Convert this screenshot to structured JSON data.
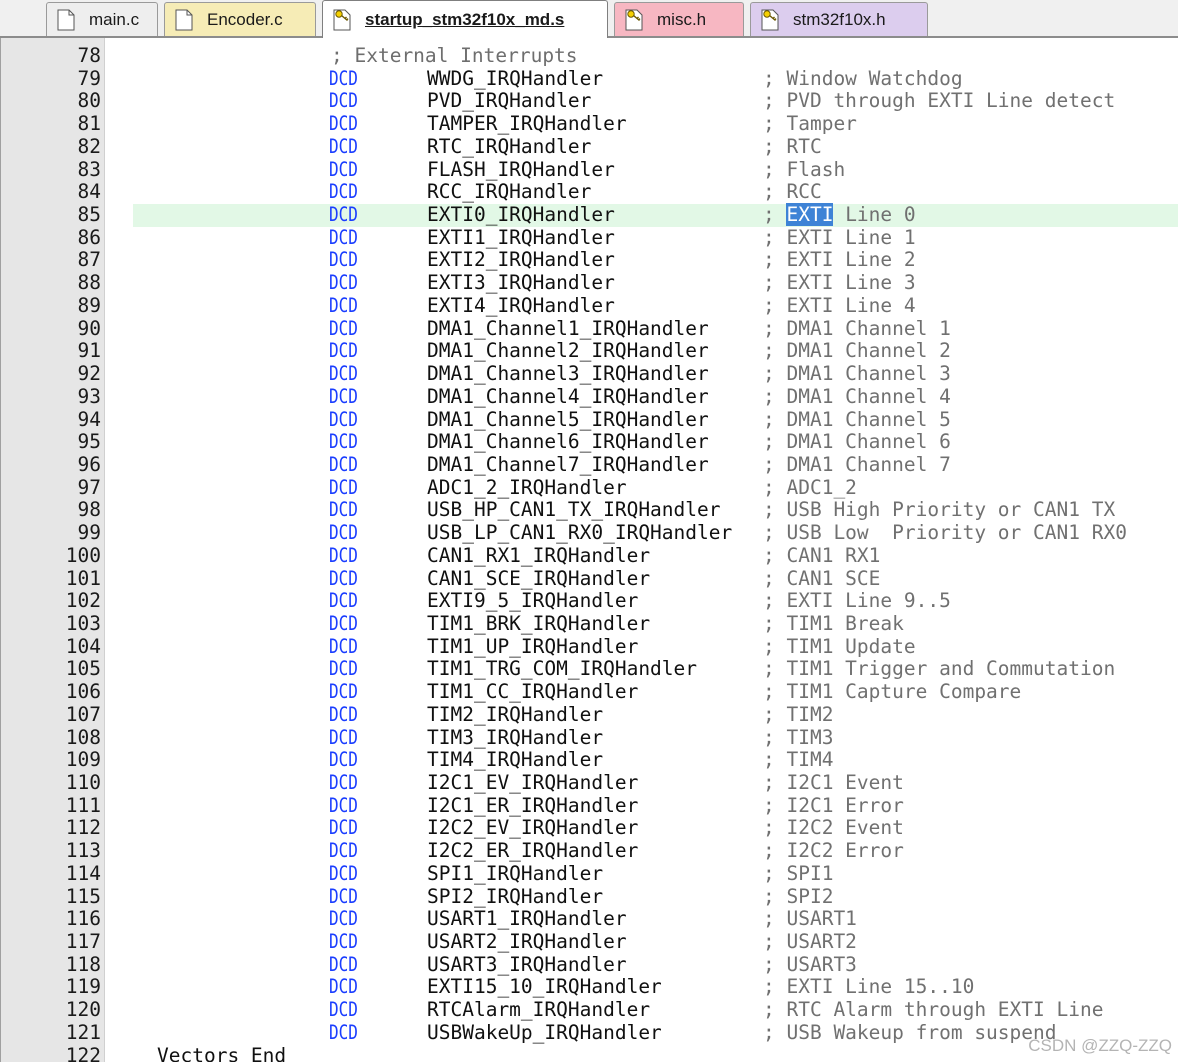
{
  "tabs": [
    {
      "label": "main.c",
      "icon": "file-icon",
      "bg": "#eeeeee",
      "active": false
    },
    {
      "label": "Encoder.c",
      "icon": "file-icon",
      "bg": "#f6ecb6",
      "active": false
    },
    {
      "label": "startup_stm32f10x_md.s",
      "icon": "key-file-icon",
      "bg": "#ffffff",
      "active": true
    },
    {
      "label": "misc.h",
      "icon": "key-file-icon",
      "bg": "#f7b7c2",
      "active": false
    },
    {
      "label": "stm32f10x.h",
      "icon": "key-file-icon",
      "bg": "#dccdee",
      "active": false
    }
  ],
  "colors": {
    "keyword": "#1a3dff",
    "comment": "#707070",
    "current_line": "#e2f8e6",
    "selection": "#3e83d6"
  },
  "editor": {
    "current_line": 85,
    "lines": [
      {
        "num": "78",
        "kind": "header",
        "text": "; External Interrupts"
      },
      {
        "num": "79",
        "kw": "DCD",
        "name": "WWDG_IRQHandler",
        "comment": "; Window Watchdog"
      },
      {
        "num": "80",
        "kw": "DCD",
        "name": "PVD_IRQHandler",
        "comment": "; PVD through EXTI Line detect"
      },
      {
        "num": "81",
        "kw": "DCD",
        "name": "TAMPER_IRQHandler",
        "comment": "; Tamper"
      },
      {
        "num": "82",
        "kw": "DCD",
        "name": "RTC_IRQHandler",
        "comment": "; RTC"
      },
      {
        "num": "83",
        "kw": "DCD",
        "name": "FLASH_IRQHandler",
        "comment": "; Flash"
      },
      {
        "num": "84",
        "kw": "DCD",
        "name": "RCC_IRQHandler",
        "comment": "; RCC"
      },
      {
        "num": "85",
        "kw": "DCD",
        "name": "EXTI0_IRQHandler",
        "comment": "; EXTI Line 0",
        "sel_pre": "; ",
        "sel": "EXTI",
        "sel_post": " Line 0"
      },
      {
        "num": "86",
        "kw": "DCD",
        "name": "EXTI1_IRQHandler",
        "comment": "; EXTI Line 1"
      },
      {
        "num": "87",
        "kw": "DCD",
        "name": "EXTI2_IRQHandler",
        "comment": "; EXTI Line 2"
      },
      {
        "num": "88",
        "kw": "DCD",
        "name": "EXTI3_IRQHandler",
        "comment": "; EXTI Line 3"
      },
      {
        "num": "89",
        "kw": "DCD",
        "name": "EXTI4_IRQHandler",
        "comment": "; EXTI Line 4"
      },
      {
        "num": "90",
        "kw": "DCD",
        "name": "DMA1_Channel1_IRQHandler",
        "comment": "; DMA1 Channel 1"
      },
      {
        "num": "91",
        "kw": "DCD",
        "name": "DMA1_Channel2_IRQHandler",
        "comment": "; DMA1 Channel 2"
      },
      {
        "num": "92",
        "kw": "DCD",
        "name": "DMA1_Channel3_IRQHandler",
        "comment": "; DMA1 Channel 3"
      },
      {
        "num": "93",
        "kw": "DCD",
        "name": "DMA1_Channel4_IRQHandler",
        "comment": "; DMA1 Channel 4"
      },
      {
        "num": "94",
        "kw": "DCD",
        "name": "DMA1_Channel5_IRQHandler",
        "comment": "; DMA1 Channel 5"
      },
      {
        "num": "95",
        "kw": "DCD",
        "name": "DMA1_Channel6_IRQHandler",
        "comment": "; DMA1 Channel 6"
      },
      {
        "num": "96",
        "kw": "DCD",
        "name": "DMA1_Channel7_IRQHandler",
        "comment": "; DMA1 Channel 7"
      },
      {
        "num": "97",
        "kw": "DCD",
        "name": "ADC1_2_IRQHandler",
        "comment": "; ADC1_2"
      },
      {
        "num": "98",
        "kw": "DCD",
        "name": "USB_HP_CAN1_TX_IRQHandler",
        "comment": "; USB High Priority or CAN1 TX"
      },
      {
        "num": "99",
        "kw": "DCD",
        "name": "USB_LP_CAN1_RX0_IRQHandler",
        "comment": "; USB Low  Priority or CAN1 RX0"
      },
      {
        "num": "100",
        "kw": "DCD",
        "name": "CAN1_RX1_IRQHandler",
        "comment": "; CAN1 RX1"
      },
      {
        "num": "101",
        "kw": "DCD",
        "name": "CAN1_SCE_IRQHandler",
        "comment": "; CAN1 SCE"
      },
      {
        "num": "102",
        "kw": "DCD",
        "name": "EXTI9_5_IRQHandler",
        "comment": "; EXTI Line 9..5"
      },
      {
        "num": "103",
        "kw": "DCD",
        "name": "TIM1_BRK_IRQHandler",
        "comment": "; TIM1 Break"
      },
      {
        "num": "104",
        "kw": "DCD",
        "name": "TIM1_UP_IRQHandler",
        "comment": "; TIM1 Update"
      },
      {
        "num": "105",
        "kw": "DCD",
        "name": "TIM1_TRG_COM_IRQHandler",
        "comment": "; TIM1 Trigger and Commutation"
      },
      {
        "num": "106",
        "kw": "DCD",
        "name": "TIM1_CC_IRQHandler",
        "comment": "; TIM1 Capture Compare"
      },
      {
        "num": "107",
        "kw": "DCD",
        "name": "TIM2_IRQHandler",
        "comment": "; TIM2"
      },
      {
        "num": "108",
        "kw": "DCD",
        "name": "TIM3_IRQHandler",
        "comment": "; TIM3"
      },
      {
        "num": "109",
        "kw": "DCD",
        "name": "TIM4_IRQHandler",
        "comment": "; TIM4"
      },
      {
        "num": "110",
        "kw": "DCD",
        "name": "I2C1_EV_IRQHandler",
        "comment": "; I2C1 Event"
      },
      {
        "num": "111",
        "kw": "DCD",
        "name": "I2C1_ER_IRQHandler",
        "comment": "; I2C1 Error"
      },
      {
        "num": "112",
        "kw": "DCD",
        "name": "I2C2_EV_IRQHandler",
        "comment": "; I2C2 Event"
      },
      {
        "num": "113",
        "kw": "DCD",
        "name": "I2C2_ER_IRQHandler",
        "comment": "; I2C2 Error"
      },
      {
        "num": "114",
        "kw": "DCD",
        "name": "SPI1_IRQHandler",
        "comment": "; SPI1"
      },
      {
        "num": "115",
        "kw": "DCD",
        "name": "SPI2_IRQHandler",
        "comment": "; SPI2"
      },
      {
        "num": "116",
        "kw": "DCD",
        "name": "USART1_IRQHandler",
        "comment": "; USART1"
      },
      {
        "num": "117",
        "kw": "DCD",
        "name": "USART2_IRQHandler",
        "comment": "; USART2"
      },
      {
        "num": "118",
        "kw": "DCD",
        "name": "USART3_IRQHandler",
        "comment": "; USART3"
      },
      {
        "num": "119",
        "kw": "DCD",
        "name": "EXTI15_10_IRQHandler",
        "comment": "; EXTI Line 15..10"
      },
      {
        "num": "120",
        "kw": "DCD",
        "name": "RTCAlarm_IRQHandler",
        "comment": "; RTC Alarm through EXTI Line"
      },
      {
        "num": "121",
        "kw": "DCD",
        "name": "USBWakeUp_IRQHandler",
        "comment": "; USB Wakeup from suspend"
      },
      {
        "num": "122",
        "kind": "end",
        "text": "Vectors_End"
      }
    ]
  },
  "watermark": "CSDN @ZZQ-ZZQ"
}
